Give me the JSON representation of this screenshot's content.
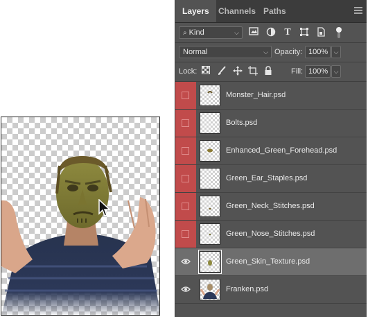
{
  "panel": {
    "tabs": [
      {
        "label": "Layers",
        "active": true
      },
      {
        "label": "Channels",
        "active": false
      },
      {
        "label": "Paths",
        "active": false
      }
    ],
    "filter": {
      "kind_label": "Kind",
      "icons": [
        "image-filter-icon",
        "adjustment-filter-icon",
        "type-filter-icon",
        "shape-filter-icon",
        "smart-object-filter-icon",
        "filter-toggle-icon"
      ]
    },
    "blend_mode": "Normal",
    "opacity_label": "Opacity:",
    "opacity_value": "100%",
    "lock_label": "Lock:",
    "lock_icons": [
      "lock-transparent-pixels-icon",
      "lock-image-pixels-icon",
      "lock-position-icon",
      "lock-artboard-icon",
      "lock-all-icon"
    ],
    "fill_label": "Fill:",
    "fill_value": "100%"
  },
  "layers": [
    {
      "name": "Monster_Hair.psd",
      "visible": false,
      "selected": false,
      "thumb": "hair"
    },
    {
      "name": "Bolts.psd",
      "visible": false,
      "selected": false,
      "thumb": "empty"
    },
    {
      "name": "Enhanced_Green_Forehead.psd",
      "visible": false,
      "selected": false,
      "thumb": "forehead"
    },
    {
      "name": "Green_Ear_Staples.psd",
      "visible": false,
      "selected": false,
      "thumb": "empty"
    },
    {
      "name": "Green_Neck_Stitches.psd",
      "visible": false,
      "selected": false,
      "thumb": "neck"
    },
    {
      "name": "Green_Nose_Stitches.psd",
      "visible": false,
      "selected": false,
      "thumb": "nose"
    },
    {
      "name": "Green_Skin_Texture.psd",
      "visible": true,
      "selected": true,
      "thumb": "skin"
    },
    {
      "name": "Franken.psd",
      "visible": true,
      "selected": false,
      "thumb": "person"
    }
  ],
  "colors": {
    "panel_bg": "#535353",
    "hidden_layer_red": "#c14b4b",
    "selected_row": "#6e6e6e"
  }
}
